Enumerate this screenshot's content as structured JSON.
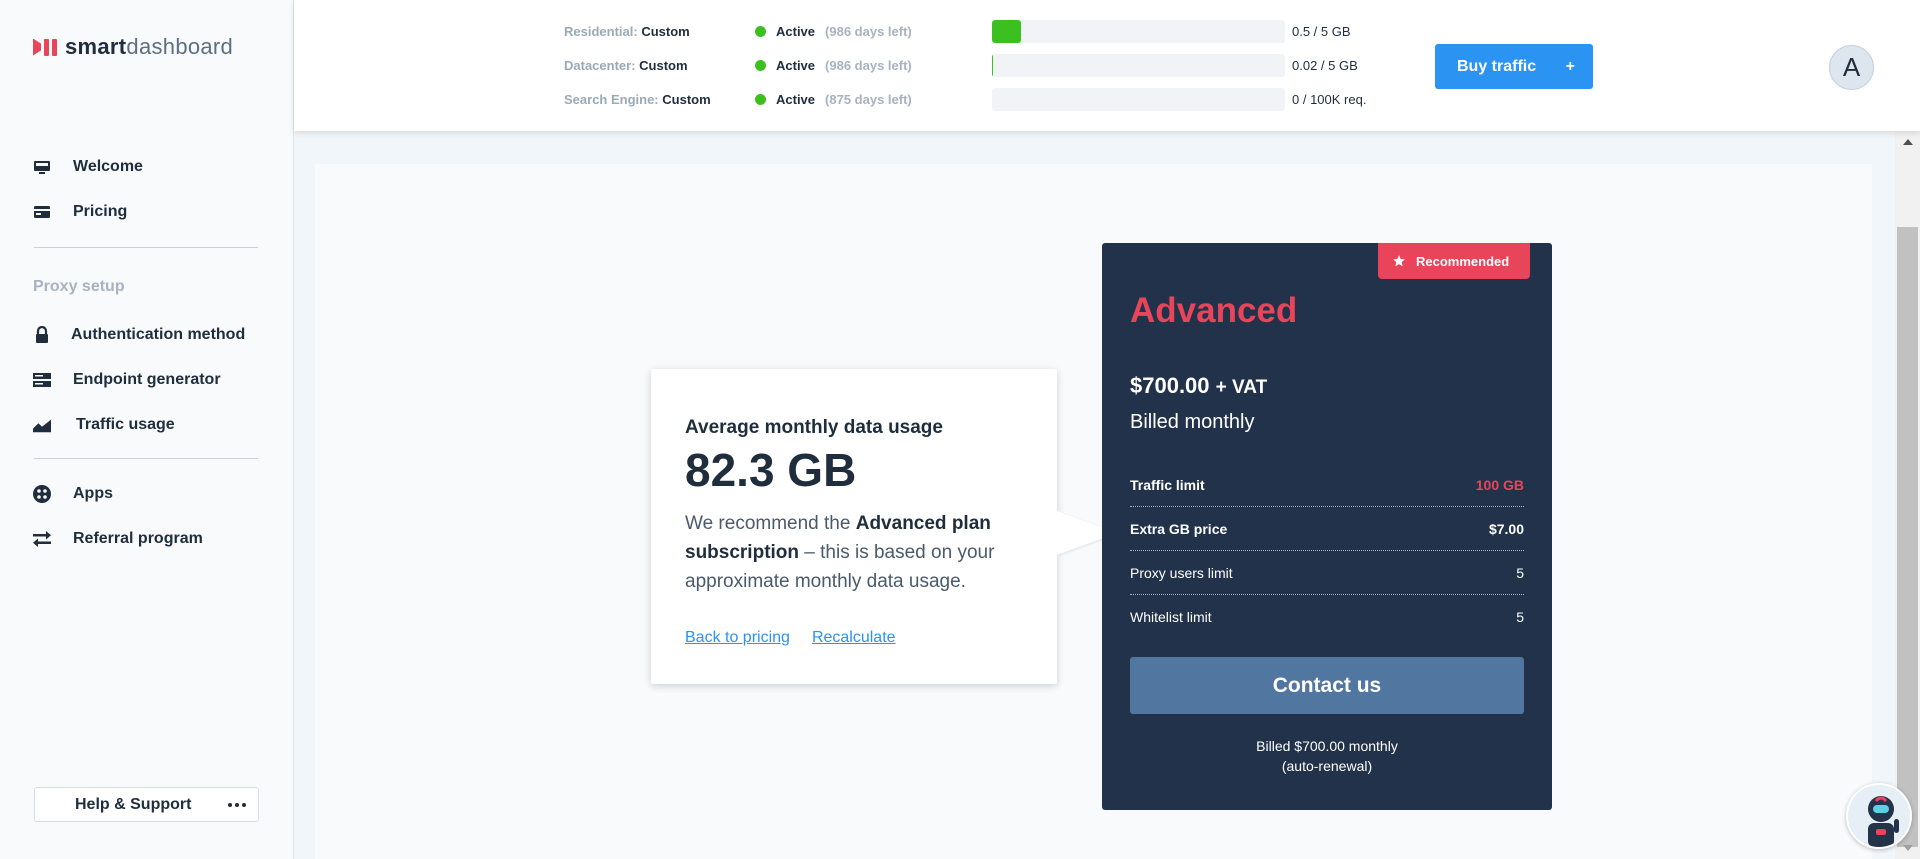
{
  "brand": {
    "name_bold": "smart",
    "name_light": "dashboard"
  },
  "sidebar": {
    "items": [
      {
        "label": "Welcome",
        "icon": "monitor-icon"
      },
      {
        "label": "Pricing",
        "icon": "card-icon"
      }
    ],
    "section_label": "Proxy setup",
    "proxy_items": [
      {
        "label": "Authentication method",
        "icon": "lock-icon"
      },
      {
        "label": "Endpoint generator",
        "icon": "server-icon"
      },
      {
        "label": "Traffic usage",
        "icon": "area-chart-icon"
      }
    ],
    "other_items": [
      {
        "label": "Apps",
        "icon": "apps-icon"
      },
      {
        "label": "Referral program",
        "icon": "exchange-icon"
      }
    ],
    "help_label": "Help & Support"
  },
  "header": {
    "usage": [
      {
        "type": "Residential:",
        "plan": "Custom",
        "status": "Active",
        "days": "(986 days left)",
        "amount": "0.5 / 5 GB",
        "progress": 0.1
      },
      {
        "type": "Datacenter:",
        "plan": "Custom",
        "status": "Active",
        "days": "(986 days left)",
        "amount": "0.02 / 5 GB",
        "progress": 0.004
      },
      {
        "type": "Search Engine:",
        "plan": "Custom",
        "status": "Active",
        "days": "(875 days left)",
        "amount": "0 / 100K req.",
        "progress": 0
      }
    ],
    "buy_label": "Buy traffic",
    "buy_plus": "+",
    "avatar_initial": "A"
  },
  "recommendation": {
    "label": "Average monthly data usage",
    "value": "82.3 GB",
    "desc_prefix": "We recommend the ",
    "desc_plan": "Advanced plan subscription",
    "desc_suffix": " – this is based on your approximate monthly data usage.",
    "back_link": "Back to pricing",
    "recalc_link": "Recalculate"
  },
  "plan": {
    "badge": "Recommended",
    "title": "Advanced",
    "price": "$700.00",
    "vat": "+ VAT",
    "billing": "Billed monthly",
    "specs": [
      {
        "label": "Traffic limit",
        "value": "100 GB"
      },
      {
        "label": "Extra GB price",
        "value": "$7.00"
      },
      {
        "label": "Proxy users limit",
        "value": "5"
      },
      {
        "label": "Whitelist limit",
        "value": "5"
      }
    ],
    "contact_label": "Contact us",
    "footer_line1": "Billed $700.00 monthly",
    "footer_line2": "(auto-renewal)"
  },
  "colors": {
    "accent": "#2b93f2",
    "brand_red": "#e8445a",
    "active_green": "#3cc01f",
    "plan_bg": "#22324a"
  }
}
